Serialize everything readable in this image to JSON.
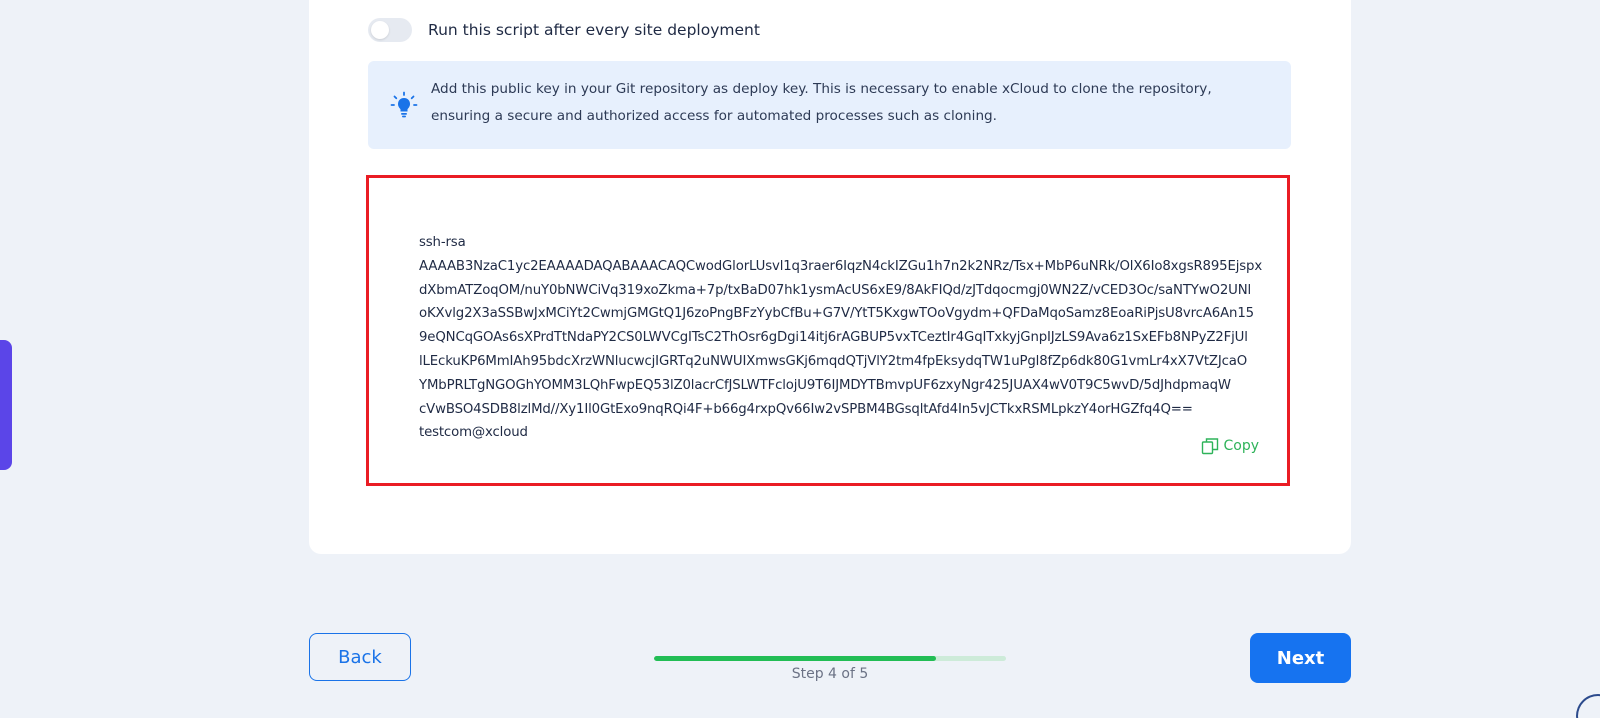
{
  "toggle": {
    "label": "Run this script after every site deployment",
    "enabled": false
  },
  "info": {
    "icon": "lightbulb-icon",
    "text": "Add this public key in your Git repository as deploy key. This is necessary to enable xCloud to clone the repository, ensuring a secure and authorized access for automated processes such as cloning."
  },
  "public_key": {
    "lines": [
      "ssh-rsa",
      "AAAAB3NzaC1yc2EAAAADAQABAAACAQCwodGlorLUsvl1q3raer6IqzN4ckIZGu1h7n2k2NRz/Tsx+MbP6uNRk/OlX6Io8xgsR895Ejspx",
      "dXbmATZoqOM/nuY0bNWCiVq319xoZkma+7p/txBaD07hk1ysmAcUS6xE9/8AkFIQd/zJTdqocmgj0WN2Z/vCED3Oc/saNTYwO2UNl",
      "oKXvlg2X3aSSBwJxMCiYt2CwmjGMGtQ1J6zoPngBFzYybCfBu+G7V/YtT5KxgwTOoVgydm+QFDaMqoSamz8EoaRiPjsU8vrcA6An15",
      "9eQNCqGOAs6sXPrdTtNdaPY2CS0LWVCgITsC2ThOsr6gDgi14itj6rAGBUP5vxTCeztIr4GqITxkyjGnpIJzLS9Ava6z1SxEFb8NPyZ2FjUl",
      "lLEckuKP6MmIAh95bdcXrzWNlucwcjIGRTq2uNWUIXmwsGKj6mqdQTjVlY2tm4fpEksydqTW1uPgl8fZp6dk80G1vmLr4xX7VtZJcaO",
      "YMbPRLTgNGOGhYOMM3LQhFwpEQ53lZ0lacrCfJSLWTFclojU9T6IJMDYTBmvpUF6zxyNgr425JUAX4wV0T9C5wvD/5dJhdpmaqW",
      "cVwBSO4SDB8lzlMd//Xy1Il0GtExo9nqRQi4F+b66g4rxpQv66Iw2vSPBM4BGsqltAfd4In5vJCTkxRSMLpkzY4orHGZfq4Q==",
      "testcom@xcloud"
    ],
    "copy_label": "Copy",
    "copy_icon": "copy-icon"
  },
  "navigation": {
    "back_label": "Back",
    "next_label": "Next",
    "step_label": "Step 4 of 5",
    "progress_fraction": 0.8
  },
  "colors": {
    "accent": "#1673f0",
    "success": "#22bd55",
    "highlight_border": "#ea1c24",
    "side_tab": "#5b45e8",
    "info_background": "#e7f0fd"
  }
}
